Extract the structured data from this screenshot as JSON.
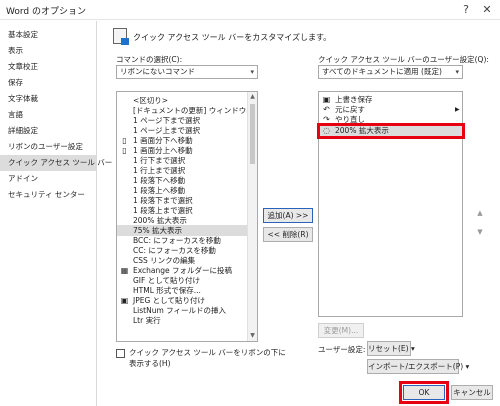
{
  "window": {
    "title": "Word のオプション",
    "help_glyph": "?",
    "close_glyph": "✕"
  },
  "sidebar": {
    "items": [
      {
        "label": "基本設定"
      },
      {
        "label": "表示"
      },
      {
        "label": "文章校正"
      },
      {
        "label": "保存"
      },
      {
        "label": "文字体裁"
      },
      {
        "label": "言語"
      },
      {
        "label": "詳細設定"
      },
      {
        "label": "リボンのユーザー設定"
      },
      {
        "label": "クイック アクセス ツール バー"
      },
      {
        "label": "アドイン"
      },
      {
        "label": "セキュリティ センター"
      }
    ]
  },
  "header": {
    "text": "クイック アクセス ツール バーをカスタマイズします。"
  },
  "commands": {
    "label": "コマンドの選択(C):",
    "selected": "リボンにないコマンド",
    "items": [
      {
        "icon": "",
        "label": "<区切り>"
      },
      {
        "icon": "",
        "label": "[ドキュメントの更新] ウィンドウの..."
      },
      {
        "icon": "",
        "label": "1 ページ下まで選択"
      },
      {
        "icon": "",
        "label": "1 ページ上まで選択"
      },
      {
        "icon": "▯",
        "label": "1 画面分下へ移動"
      },
      {
        "icon": "▯",
        "label": "1 画面分上へ移動"
      },
      {
        "icon": "",
        "label": "1 行下まで選択"
      },
      {
        "icon": "",
        "label": "1 行上まで選択"
      },
      {
        "icon": "",
        "label": "1 段落下へ移動"
      },
      {
        "icon": "",
        "label": "1 段落上へ移動"
      },
      {
        "icon": "",
        "label": "1 段落下まで選択"
      },
      {
        "icon": "",
        "label": "1 段落上まで選択"
      },
      {
        "icon": "",
        "label": "200% 拡大表示"
      },
      {
        "icon": "",
        "label": "75% 拡大表示"
      },
      {
        "icon": "",
        "label": "BCC: にフォーカスを移動"
      },
      {
        "icon": "",
        "label": "CC: にフォーカスを移動"
      },
      {
        "icon": "",
        "label": "CSS リンクの編集"
      },
      {
        "icon": "▦",
        "label": "Exchange フォルダーに投稿"
      },
      {
        "icon": "",
        "label": "GIF として貼り付け"
      },
      {
        "icon": "",
        "label": "HTML 形式で保存..."
      },
      {
        "icon": "▣",
        "label": "JPEG として貼り付け"
      },
      {
        "icon": "",
        "label": "ListNum フィールドの挿入"
      },
      {
        "icon": "",
        "label": "Ltr 実行"
      }
    ]
  },
  "qat": {
    "label": "クイック アクセス ツール バーのユーザー設定(Q):",
    "selected": "すべてのドキュメントに適用 (既定)",
    "items": [
      {
        "icon": "▣",
        "label": "上書き保存"
      },
      {
        "icon": "↶",
        "label": "元に戻す"
      },
      {
        "icon": "↷",
        "label": "やり直し"
      },
      {
        "icon": "◌",
        "label": "200% 拡大表示"
      }
    ],
    "submenu_glyph": "▶"
  },
  "buttons": {
    "add": "追加(A) >>",
    "remove": "<< 削除(R)",
    "modify": "変更(M)...",
    "reset": "リセット(E) ▾",
    "import_export": "インポート/エクスポート(P) ▾",
    "ok": "OK",
    "cancel": "キャンセル"
  },
  "user_settings_label": "ユーザー設定:",
  "checkbox": {
    "label": "クイック アクセス ツール バーをリボンの下に表示する(H)"
  },
  "arrows": {
    "up": "▲",
    "down": "▼",
    "dropdown": "▾"
  },
  "colors": {
    "highlight": "#e60012",
    "primary_border": "#2a63b8",
    "selection": "#dcdcdc"
  }
}
